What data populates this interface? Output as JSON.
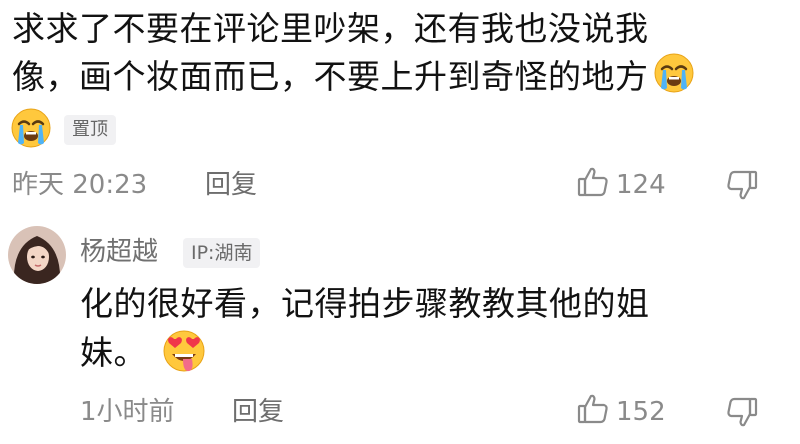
{
  "comment": {
    "line1": "求求了不要在评论里吵架，还有我也没说我",
    "line2": "像，画个妆面而已，不要上升到奇怪的地方",
    "pinned_label": "置顶",
    "time": "昨天 20:23",
    "reply_label": "回复",
    "like_count": "124"
  },
  "reply": {
    "username": "杨超越",
    "ip_label": "IP:湖南",
    "line1": "化的很好看，记得拍步骤教教其他的姐",
    "line2": "妹。",
    "time": "1小时前",
    "reply_label": "回复",
    "like_count": "152"
  },
  "icons": {
    "like": "thumbs-up-icon",
    "dislike": "thumbs-down-icon",
    "crying": "loudly-crying-face-icon",
    "heart_eyes": "heart-eyes-tongue-face-icon"
  },
  "colors": {
    "text_primary": "#121212",
    "text_secondary": "#8a8a8a",
    "badge_bg": "#f1f1f3"
  }
}
